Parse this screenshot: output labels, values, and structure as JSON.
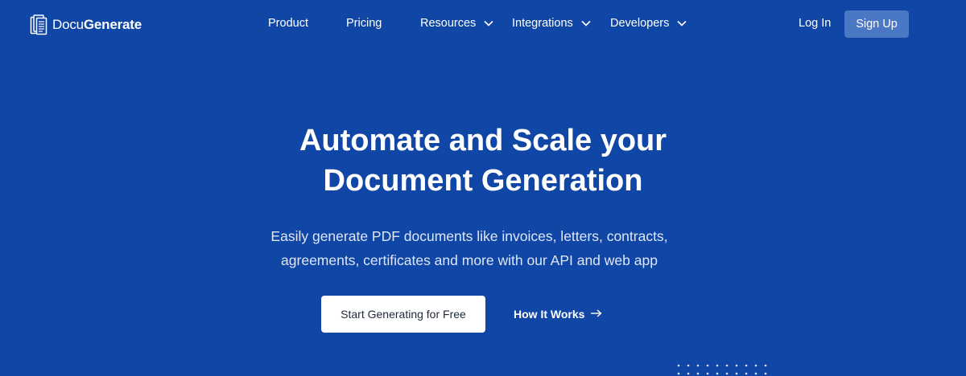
{
  "brand": {
    "name_light": "Docu",
    "name_bold": "Generate",
    "logo_icon": "documents-stack-icon"
  },
  "nav": {
    "items": [
      {
        "label": "Product",
        "has_dropdown": false
      },
      {
        "label": "Pricing",
        "has_dropdown": false
      },
      {
        "label": "Resources",
        "has_dropdown": true
      },
      {
        "label": "Integrations",
        "has_dropdown": true
      },
      {
        "label": "Developers",
        "has_dropdown": true
      }
    ],
    "login_label": "Log In",
    "signup_label": "Sign Up"
  },
  "hero": {
    "title_line1": "Automate and Scale your",
    "title_line2": "Document Generation",
    "subtitle_line1": "Easily generate PDF documents like invoices, letters, contracts,",
    "subtitle_line2": "agreements, certificates and more with our API and web app",
    "primary_cta": "Start Generating for Free",
    "secondary_cta": "How It Works",
    "secondary_cta_icon": "arrow-right-icon"
  },
  "colors": {
    "background": "#1046a6",
    "signup_button": "#4a78c4",
    "primary_button_bg": "#ffffff",
    "primary_button_text": "#1f2937"
  }
}
